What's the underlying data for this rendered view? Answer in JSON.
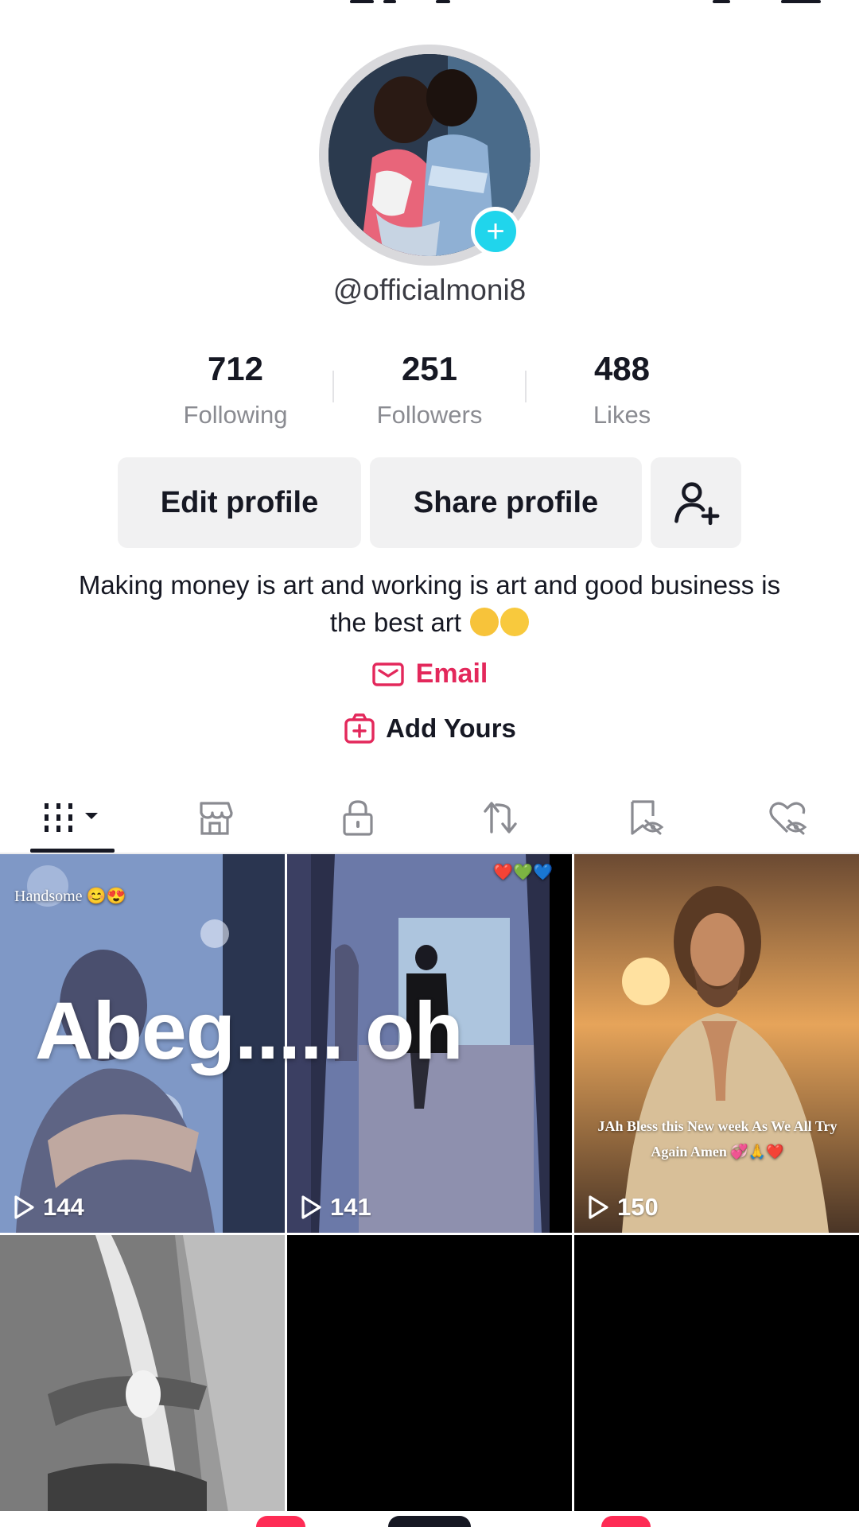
{
  "profile": {
    "username": "@officialmoni8",
    "avatar_add_symbol": "+"
  },
  "stats": [
    {
      "value": "712",
      "label": "Following"
    },
    {
      "value": "251",
      "label": "Followers"
    },
    {
      "value": "488",
      "label": "Likes"
    }
  ],
  "actions": {
    "edit_label": "Edit profile",
    "share_label": "Share profile",
    "add_friend_icon": "add-person-icon"
  },
  "bio": {
    "text": "Making money is art and working is art and good business is the best art",
    "emojis": [
      "cat-tears-of-joy",
      "winking-tongue-face"
    ]
  },
  "links": {
    "email_label": "Email",
    "add_yours_label": "Add Yours"
  },
  "tabs": [
    {
      "icon": "grid-videos-icon",
      "active": true
    },
    {
      "icon": "shop-icon"
    },
    {
      "icon": "lock-icon"
    },
    {
      "icon": "repost-icon"
    },
    {
      "icon": "favorites-hidden-icon"
    },
    {
      "icon": "liked-hidden-icon"
    }
  ],
  "videos": [
    {
      "views": "144",
      "caption": "Handsome 😊😍"
    },
    {
      "views": "141",
      "caption": "❤️💚💙"
    },
    {
      "views": "150",
      "caption": "JAh Bless this New week As We All Try Again Amen 💞🙏❤️"
    },
    {
      "views": ""
    },
    {
      "views": ""
    },
    {
      "views": ""
    }
  ],
  "overlay": {
    "text": "Abeg..... oh"
  },
  "colors": {
    "accent": "#e3285b",
    "avatar_badge": "#20d5ec",
    "button_bg": "#f1f1f2"
  }
}
